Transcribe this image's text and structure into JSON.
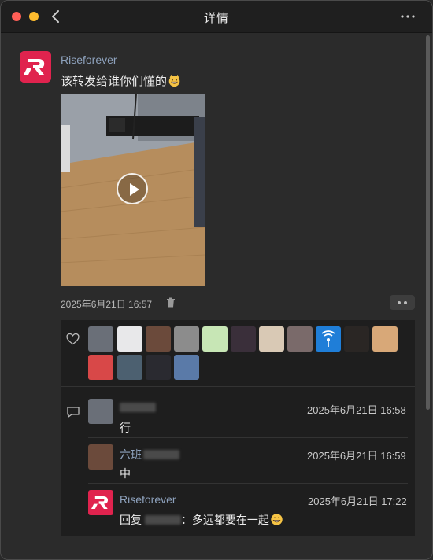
{
  "window": {
    "title": "详情"
  },
  "post": {
    "author": "Riseforever",
    "text": "该转发给谁你们懂的",
    "emoji": "cat-grin",
    "timestamp": "2025年6月21日 16:57"
  },
  "likes": {
    "count": 17,
    "colors": [
      "#6a6f78",
      "#e8e8ea",
      "#6b4a3b",
      "#8c8c8c",
      "#c7e6b5",
      "#3a2f3a",
      "#d9c9b5",
      "#7a6a6a",
      "#1f7ed8",
      "#2a2624",
      "#d8a878",
      "#d84848",
      "#4c6070",
      "#2a2a30",
      "#5a7aa8"
    ]
  },
  "comments": [
    {
      "name": "",
      "time": "2025年6月21日 16:58",
      "text": "行"
    },
    {
      "name": "六班",
      "time": "2025年6月21日 16:59",
      "text": "中"
    },
    {
      "name": "Riseforever",
      "time": "2025年6月21日 17:22",
      "text": "回复",
      "text_tail": "：多远都要在一起",
      "emoji": "grinning-face"
    }
  ]
}
